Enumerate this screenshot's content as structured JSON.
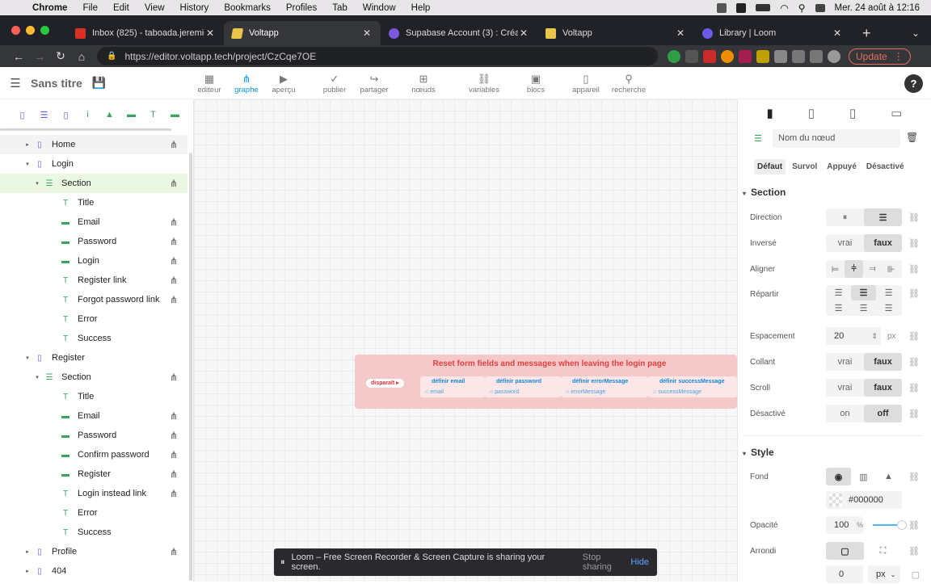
{
  "macos_menu": {
    "items": [
      "Chrome",
      "File",
      "Edit",
      "View",
      "History",
      "Bookmarks",
      "Profiles",
      "Tab",
      "Window",
      "Help"
    ],
    "clock": "Mer. 24 août à 12:16"
  },
  "browser": {
    "tabs": [
      {
        "title": "Inbox (825) - taboada.jeremie@",
        "color": "#d93025"
      },
      {
        "title": "Voltapp",
        "color": "#e9c44a"
      },
      {
        "title": "Supabase Account (3) : Créatio",
        "color": "#7a59e0"
      },
      {
        "title": "Voltapp",
        "color": "#e9c44a"
      },
      {
        "title": "Library | Loom",
        "color": "#6d5ae6"
      }
    ],
    "url": "https://editor.voltapp.tech/project/CzCqe7OE",
    "update_label": "Update"
  },
  "app": {
    "title": "Sans titre",
    "tools": [
      {
        "label": "editeur",
        "icon": "▦"
      },
      {
        "label": "graphe",
        "icon": "⋔"
      },
      {
        "label": "aperçu",
        "icon": "▶"
      },
      {
        "label": "publier",
        "icon": "✓"
      },
      {
        "label": "partager",
        "icon": "↪"
      },
      {
        "label": "nœuds",
        "icon": "⊞"
      },
      {
        "label": "variables",
        "icon": "⛓"
      },
      {
        "label": "blocs",
        "icon": "▣"
      },
      {
        "label": "appareil",
        "icon": "▯"
      },
      {
        "label": "recherche",
        "icon": "⚲"
      }
    ],
    "help": "?"
  },
  "tree": [
    {
      "label": "Home",
      "type": "page",
      "level": 0,
      "caret": "▸",
      "share": true
    },
    {
      "label": "Login",
      "type": "page",
      "level": 0,
      "caret": "▾",
      "share": false
    },
    {
      "label": "Section",
      "type": "sect",
      "level": 1,
      "caret": "▾",
      "share": true
    },
    {
      "label": "Title",
      "type": "txt",
      "level": 2,
      "caret": "",
      "share": false
    },
    {
      "label": "Email",
      "type": "inp",
      "level": 2,
      "caret": "",
      "share": true
    },
    {
      "label": "Password",
      "type": "inp",
      "level": 2,
      "caret": "",
      "share": true
    },
    {
      "label": "Login",
      "type": "inp",
      "level": 2,
      "caret": "",
      "share": true
    },
    {
      "label": "Register link",
      "type": "txt",
      "level": 2,
      "caret": "",
      "share": true
    },
    {
      "label": "Forgot password link",
      "type": "txt",
      "level": 2,
      "caret": "",
      "share": true
    },
    {
      "label": "Error",
      "type": "txt",
      "level": 2,
      "caret": "",
      "share": false
    },
    {
      "label": "Success",
      "type": "txt",
      "level": 2,
      "caret": "",
      "share": false
    },
    {
      "label": "Register",
      "type": "page",
      "level": 0,
      "caret": "▾",
      "share": false
    },
    {
      "label": "Section",
      "type": "sect",
      "level": 1,
      "caret": "▾",
      "share": true
    },
    {
      "label": "Title",
      "type": "txt",
      "level": 2,
      "caret": "",
      "share": false
    },
    {
      "label": "Email",
      "type": "inp",
      "level": 2,
      "caret": "",
      "share": true
    },
    {
      "label": "Password",
      "type": "inp",
      "level": 2,
      "caret": "",
      "share": true
    },
    {
      "label": "Confirm password",
      "type": "inp",
      "level": 2,
      "caret": "",
      "share": true
    },
    {
      "label": "Register",
      "type": "inp",
      "level": 2,
      "caret": "",
      "share": true
    },
    {
      "label": "Login instead link",
      "type": "txt",
      "level": 2,
      "caret": "",
      "share": true
    },
    {
      "label": "Error",
      "type": "txt",
      "level": 2,
      "caret": "",
      "share": false
    },
    {
      "label": "Success",
      "type": "txt",
      "level": 2,
      "caret": "",
      "share": false
    },
    {
      "label": "Profile",
      "type": "page",
      "level": 0,
      "caret": "▸",
      "share": true
    },
    {
      "label": "404",
      "type": "page",
      "level": 0,
      "caret": "▸",
      "share": false
    }
  ],
  "flow": {
    "title": "Reset form fields and messages when leaving the login page",
    "trigger": "disparaît",
    "nodes": [
      {
        "label": "définir email",
        "sub": "email"
      },
      {
        "label": "définir password",
        "sub": "password"
      },
      {
        "label": "définir errorMessage",
        "sub": "errorMessage"
      },
      {
        "label": "définir successMessage",
        "sub": "successMessage"
      }
    ]
  },
  "loom": {
    "text": "Loom – Free Screen Recorder & Screen Capture is sharing your screen.",
    "stop": "Stop sharing",
    "hide": "Hide"
  },
  "inspector": {
    "node_name_placeholder": "Nom du nœud",
    "states": [
      "Défaut",
      "Survol",
      "Appuyé",
      "Désactivé"
    ],
    "section_title": "Section",
    "direction": "Direction",
    "inverse": "Inversé",
    "align": "Aligner",
    "repartir": "Répartir",
    "espacement": "Espacement",
    "espacement_value": "20",
    "espacement_unit": "px",
    "collant": "Collant",
    "scroll": "Scroll",
    "desactive": "Désactivé",
    "vrai": "vrai",
    "faux": "faux",
    "on": "on",
    "off": "off",
    "style_title": "Style",
    "fond": "Fond",
    "fond_value": "#000000",
    "opacite": "Opacité",
    "opacite_value": "100",
    "opacite_unit": "%",
    "arrondi": "Arrondi",
    "arrondi_value": "0",
    "arrondi_unit": "px"
  }
}
